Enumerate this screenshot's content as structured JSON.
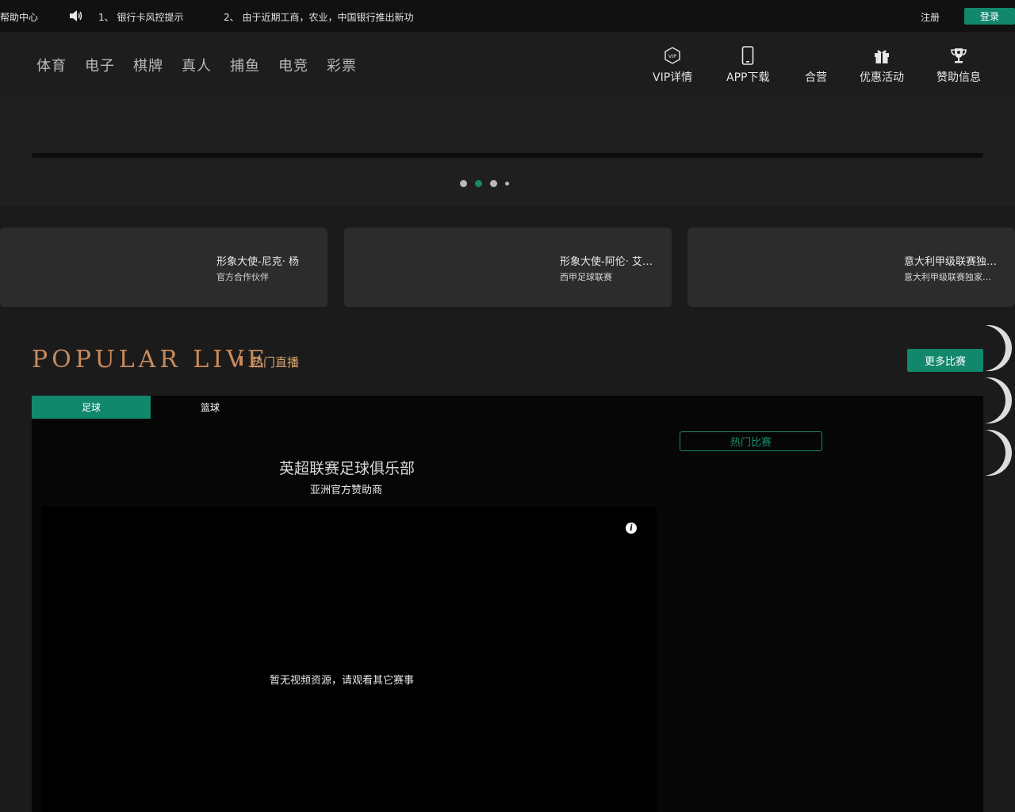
{
  "topbar": {
    "help": "帮助中心",
    "notice_1": "1、 银行卡风控提示",
    "notice_2": "2、 由于近期工商，农业，中国银行推出新功",
    "register": "注册",
    "login": "登录"
  },
  "nav": {
    "categories": [
      "体育",
      "电子",
      "棋牌",
      "真人",
      "捕鱼",
      "电竞",
      "彩票"
    ],
    "tools": [
      {
        "label": "VIP详情",
        "icon": "vip-icon"
      },
      {
        "label": "APP下载",
        "icon": "phone-icon"
      },
      {
        "label": "合营",
        "icon": "none"
      },
      {
        "label": "优惠活动",
        "icon": "gift-icon"
      },
      {
        "label": "赞助信息",
        "icon": "trophy-icon"
      }
    ]
  },
  "banner": {
    "slides": 4,
    "active_slide": 2
  },
  "cards": [
    {
      "title": "形象大使-尼克· 杨",
      "subtitle": "官方合作伙伴"
    },
    {
      "title": "形象大使-阿伦· 艾…",
      "subtitle": "西甲足球联赛"
    },
    {
      "title": "意大利甲级联赛独…",
      "subtitle": "意大利甲级联赛独家…"
    }
  ],
  "popular_live": {
    "title_en": "POPULAR  LIVE",
    "title_cn": "热门直播",
    "more_button": "更多比赛",
    "tabs": [
      "足球",
      "篮球"
    ],
    "active_tab": "足球",
    "match_title": "英超联赛足球俱乐部",
    "match_subtitle": "亚洲官方赞助商",
    "no_video_text": "暂无视频资源，请观看其它赛事",
    "hot_button": "热门比赛"
  },
  "colors": {
    "accent_green": "#11876b",
    "gold": "#c98a5b",
    "page_bg": "#1b1b1b"
  }
}
